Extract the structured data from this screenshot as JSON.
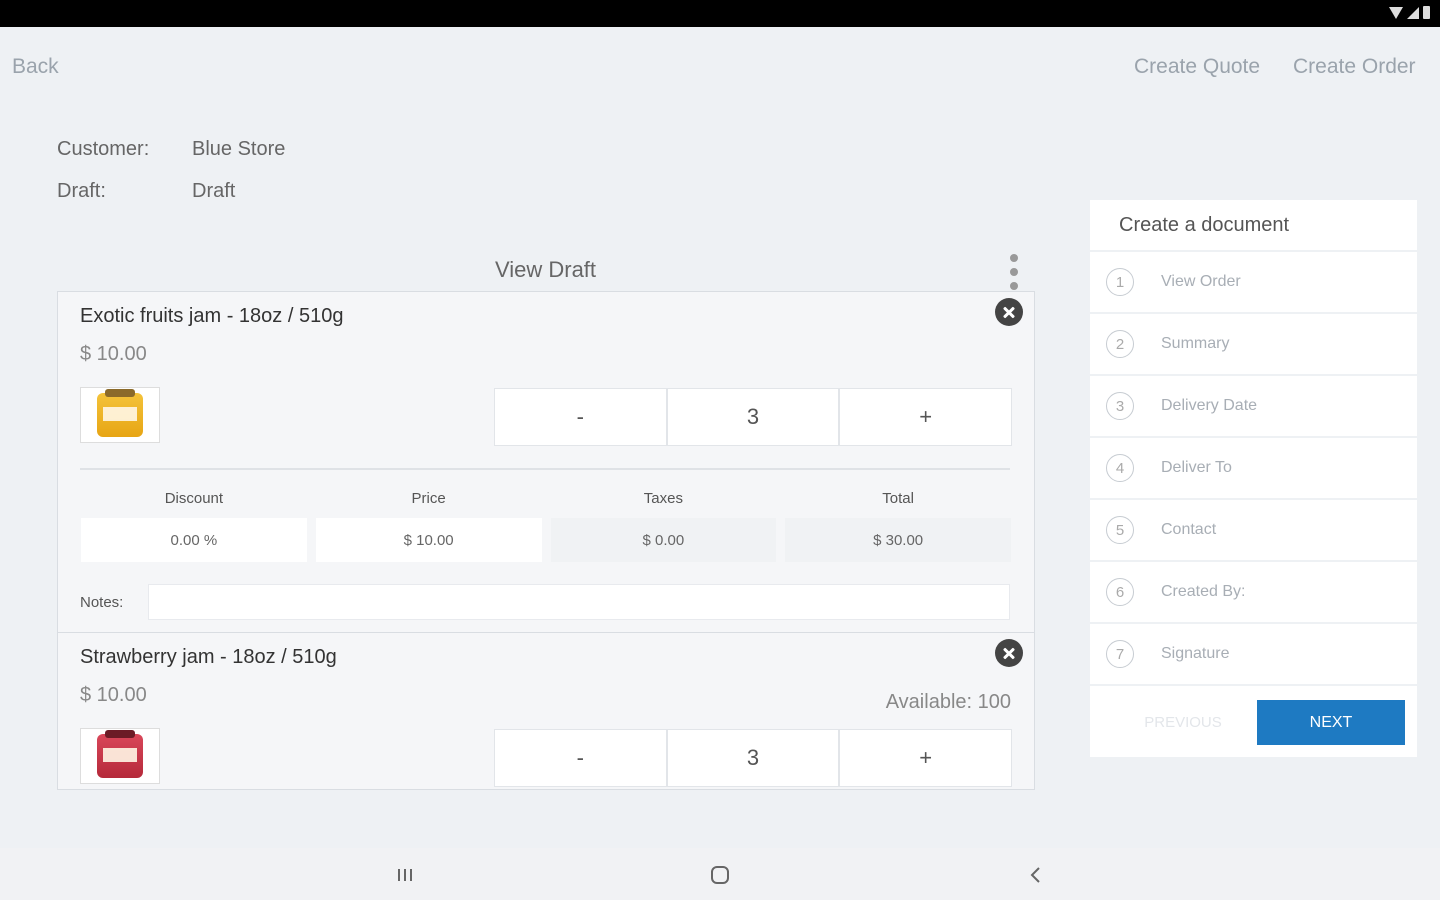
{
  "topbar": {
    "back_label": "Back",
    "create_quote_label": "Create Quote",
    "create_order_label": "Create Order"
  },
  "meta": {
    "customer_label": "Customer:",
    "customer_value": "Blue Store",
    "draft_label": "Draft:",
    "draft_value": "Draft"
  },
  "view_draft": {
    "title": "View Draft"
  },
  "items": [
    {
      "name": "Exotic fruits jam - 18oz / 510g",
      "price": "$ 10.00",
      "quantity": "3",
      "minus_label": "-",
      "plus_label": "+",
      "discount": "0.00 %",
      "unit_price": "$ 10.00",
      "taxes": "$ 0.00",
      "total": "$ 30.00"
    },
    {
      "name": "Strawberry jam - 18oz / 510g",
      "price": "$ 10.00",
      "available": "Available: 100",
      "quantity": "3",
      "minus_label": "-",
      "plus_label": "+"
    }
  ],
  "fields": {
    "discount_label": "Discount",
    "price_label": "Price",
    "taxes_label": "Taxes",
    "total_label": "Total",
    "notes_label": "Notes:"
  },
  "sidebar": {
    "title": "Create a document",
    "steps": [
      {
        "num": "1",
        "label": "View Order"
      },
      {
        "num": "2",
        "label": "Summary"
      },
      {
        "num": "3",
        "label": "Delivery Date"
      },
      {
        "num": "4",
        "label": "Deliver To"
      },
      {
        "num": "5",
        "label": "Contact"
      },
      {
        "num": "6",
        "label": "Created By:"
      },
      {
        "num": "7",
        "label": "Signature"
      }
    ],
    "previous_label": "PREVIOUS",
    "next_label": "NEXT"
  },
  "colors": {
    "accent": "#1e7ac2",
    "background": "#eef1f4"
  }
}
